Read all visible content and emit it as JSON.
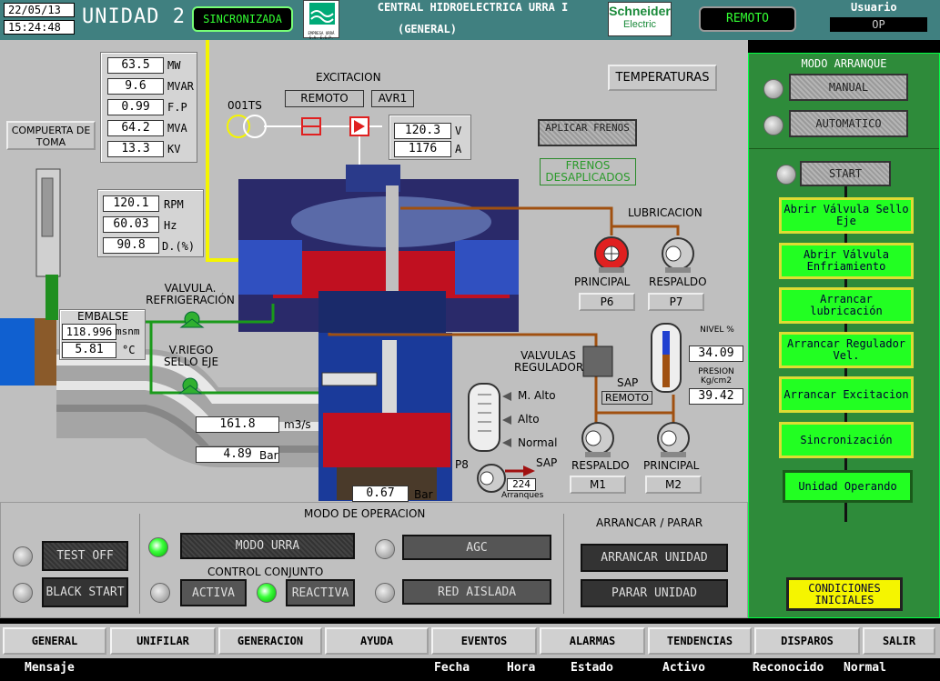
{
  "header": {
    "date": "22/05/13",
    "time": "15:24:48",
    "unit": "UNIDAD 2",
    "sync_status": "SINCRONIZADA",
    "logo_text": "EMPRESA URRÁ S.A. E.S.P.",
    "title_line1": "CENTRAL HIDROELECTRICA URRA I",
    "title_line2": "(GENERAL)",
    "brand": "Schneider",
    "brand_sub": "Electric",
    "remote": "REMOTO",
    "user_label": "Usuario",
    "user_value": "OP"
  },
  "electrical": {
    "mw": "63.5",
    "mw_u": "MW",
    "mvar": "9.6",
    "mvar_u": "MVAR",
    "fp": "0.99",
    "fp_u": "F.P",
    "mva": "64.2",
    "mva_u": "MVA",
    "kv": "13.3",
    "kv_u": "KV"
  },
  "speed": {
    "rpm": "120.1",
    "rpm_u": "RPM",
    "hz": "60.03",
    "hz_u": "Hz",
    "d": "90.8",
    "d_u": "D.(%)"
  },
  "excitation": {
    "title": "EXCITACION",
    "mode": "REMOTO",
    "avr": "AVR1",
    "breaker": "001TS",
    "v": "120.3",
    "v_u": "V",
    "a": "1176",
    "a_u": "A"
  },
  "labels": {
    "compuerta": "COMPUERTA DE TOMA",
    "temperaturas": "TEMPERATURAS",
    "aplicar_frenos": "APLICAR FRENOS",
    "frenos_status": "FRENOS DESAPLICADOS",
    "lubricacion": "LUBRICACION",
    "principal": "PRINCIPAL",
    "respaldo": "RESPALDO",
    "p6": "P6",
    "p7": "P7",
    "valvula_ref": "VALVULA. REFRIGERACIÓN",
    "valvula_riego": "V.RIEGO SELLO EJE",
    "embalse": "EMBALSE",
    "valvulas_regulador": "VALVULAS REGULADOR",
    "sap": "SAP",
    "sap_mode": "REMOTO",
    "nivel": "NIVEL %",
    "presion": "PRESION Kg/cm2",
    "m_alto": "M. Alto",
    "alto": "Alto",
    "normal": "Normal",
    "p8": "P8",
    "sap2": "SAP",
    "arranques": "Arranques",
    "m1": "M1",
    "m2": "M2",
    "respaldo2": "RESPALDO",
    "principal2": "PRINCIPAL"
  },
  "hydro": {
    "embalse_level": "118.996",
    "embalse_u": "msnm",
    "embalse_temp": "5.81",
    "temp_u": "°C",
    "flow": "161.8",
    "flow_u": "m3/s",
    "pressure": "4.89",
    "pressure_u": "Bar",
    "draft": "0.67",
    "draft_u": "Bar",
    "nivel": "34.09",
    "presion": "39.42",
    "arranques": "224"
  },
  "start_mode": {
    "title": "MODO ARRANQUE",
    "manual": "MANUAL",
    "automatico": "AUTOMATICO",
    "start": "START",
    "steps": [
      "Abrir Válvula Sello Eje",
      "Abrir Válvula Enfriamiento",
      "Arrancar lubricación",
      "Arrancar Regulador Vel.",
      "Arrancar Excitacion",
      "Sincronización",
      "Unidad Operando"
    ],
    "conditions": "CONDICIONES INICIALES"
  },
  "operation": {
    "title": "MODO DE OPERACION",
    "test_off": "TEST OFF",
    "black_start": "BLACK START",
    "modo_urra": "MODO URRA",
    "control_conjunto": "CONTROL CONJUNTO",
    "activa": "ACTIVA",
    "reactiva": "REACTIVA",
    "agc": "AGC",
    "red_aislada": "RED AISLADA",
    "arrancar_parar": "ARRANCAR / PARAR",
    "arrancar": "ARRANCAR UNIDAD",
    "parar": "PARAR UNIDAD"
  },
  "nav": [
    "GENERAL",
    "UNIFILAR",
    "GENERACION",
    "AYUDA",
    "EVENTOS",
    "ALARMAS",
    "TENDENCIAS",
    "DISPAROS",
    "SALIR"
  ],
  "alarm_headers": {
    "mensaje": "Mensaje",
    "fecha": "Fecha",
    "hora": "Hora",
    "estado": "Estado",
    "activo": "Activo",
    "reconocido": "Reconocido",
    "normal": "Normal"
  }
}
